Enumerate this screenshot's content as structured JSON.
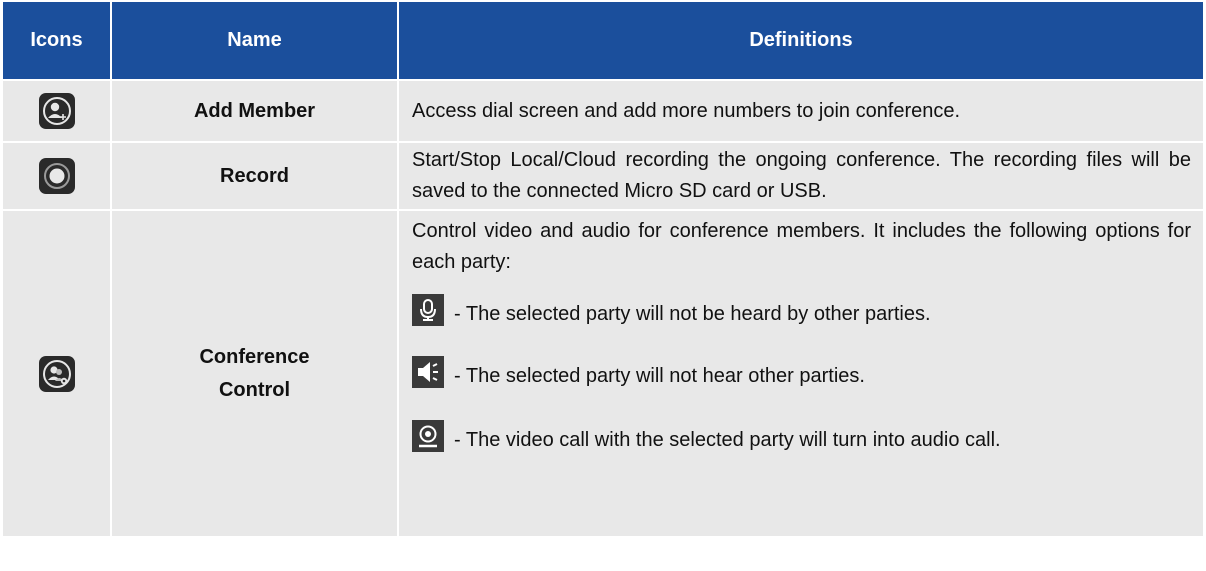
{
  "header": {
    "icons": "Icons",
    "name": "Name",
    "definitions": "Definitions"
  },
  "rows": [
    {
      "icon": "add-member-icon",
      "name": "Add Member",
      "definition": "Access dial screen and add more numbers to join conference."
    },
    {
      "icon": "record-icon",
      "name": "Record",
      "definition": "Start/Stop Local/Cloud recording the ongoing conference. The recording files will be saved to the connected Micro SD card or USB."
    },
    {
      "icon": "conference-control-icon",
      "name_line1": "Conference",
      "name_line2": "Control",
      "definition": "Control video and audio for conference members. It includes the following options for each party:",
      "options": [
        {
          "icon": "microphone-icon",
          "text": "- The selected party will not be heard by other parties."
        },
        {
          "icon": "speaker-icon",
          "text": "- The selected party will not hear other parties."
        },
        {
          "icon": "camera-icon",
          "text": "- The video call with the selected party will turn into audio call."
        }
      ]
    }
  ],
  "colors": {
    "header_bg": "#1B4F9C",
    "row_bg": "#E8E8E8",
    "icon_bg": "#2a2a2a"
  }
}
